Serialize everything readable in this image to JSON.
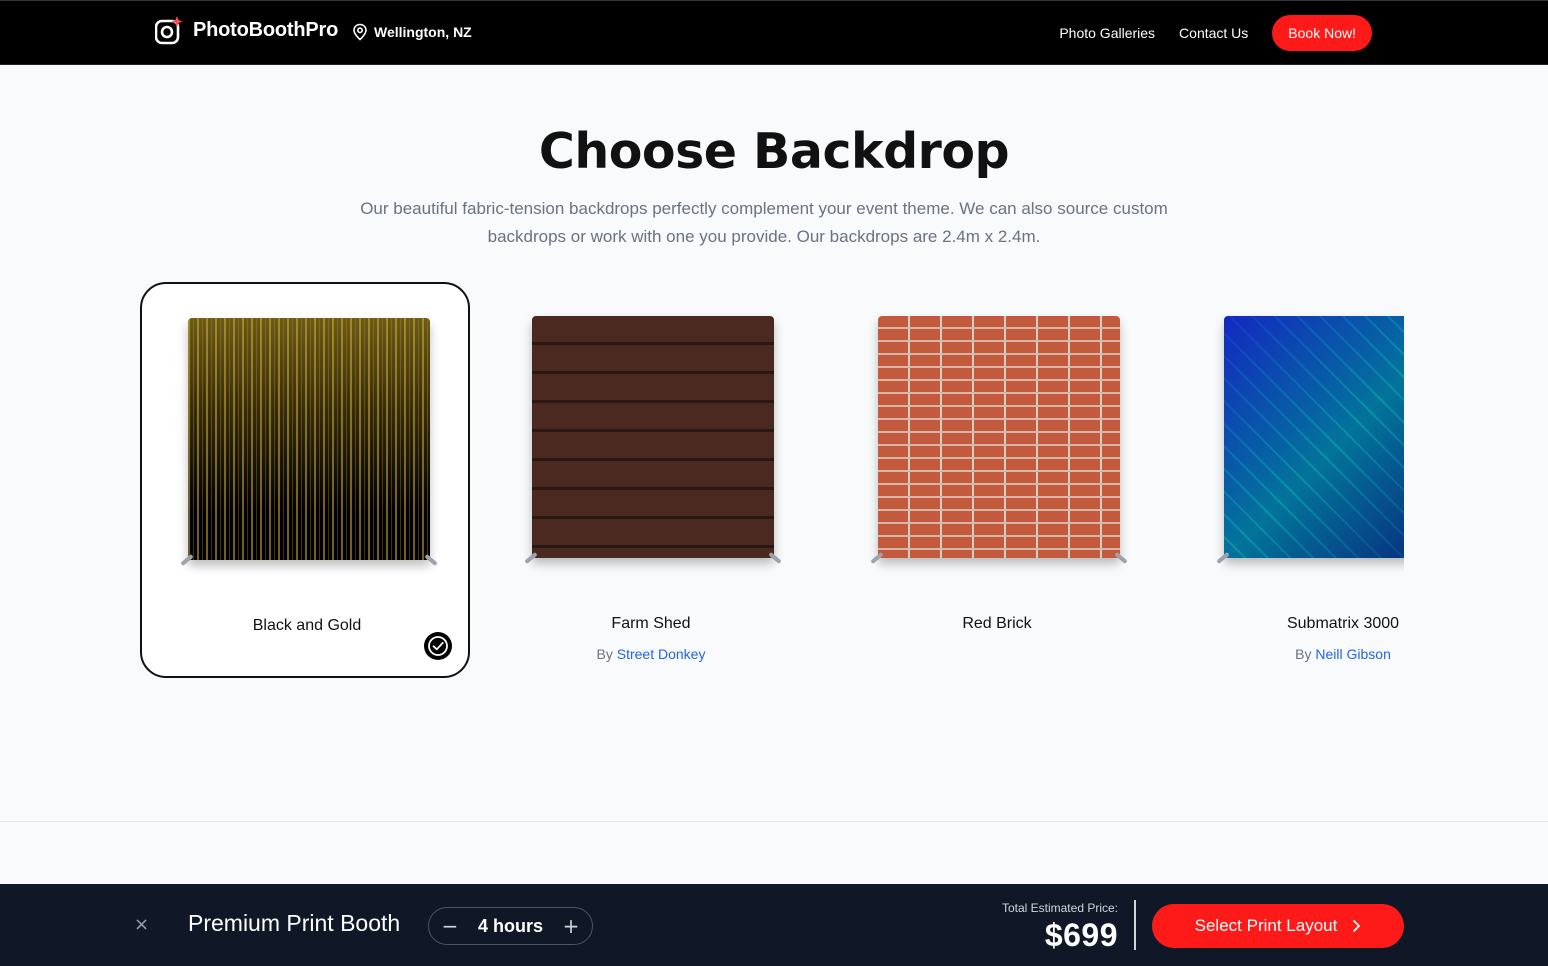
{
  "header": {
    "brand": "PhotoBoothPro",
    "location": "Wellington, NZ",
    "nav": [
      "Photo Galleries",
      "Contact Us"
    ],
    "book_label": "Book Now!"
  },
  "main": {
    "title": "Choose Backdrop",
    "subtitle": "Our beautiful fabric-tension backdrops perfectly complement your event theme. We can also source custom backdrops or work with one you provide. Our backdrops are 2.4m x 2.4m."
  },
  "backdrops": [
    {
      "name": "Black and Gold",
      "by_prefix": "",
      "author": "",
      "selected": true
    },
    {
      "name": "Farm Shed",
      "by_prefix": "By",
      "author": "Street Donkey",
      "selected": false
    },
    {
      "name": "Red Brick",
      "by_prefix": "",
      "author": "",
      "selected": false
    },
    {
      "name": "Submatrix 3000",
      "by_prefix": "By",
      "author": "Neill Gibson",
      "selected": false
    }
  ],
  "bottom_bar": {
    "package": "Premium Print Booth",
    "hours": "4 hours",
    "minus": "−",
    "plus": "+",
    "close": "×",
    "price_label": "Total Estimated Price:",
    "price": "$699",
    "cta_label": "Select Print Layout"
  },
  "colors": {
    "accent": "#ff1a1a",
    "link": "#2563eb",
    "bar_bg": "#101828"
  }
}
